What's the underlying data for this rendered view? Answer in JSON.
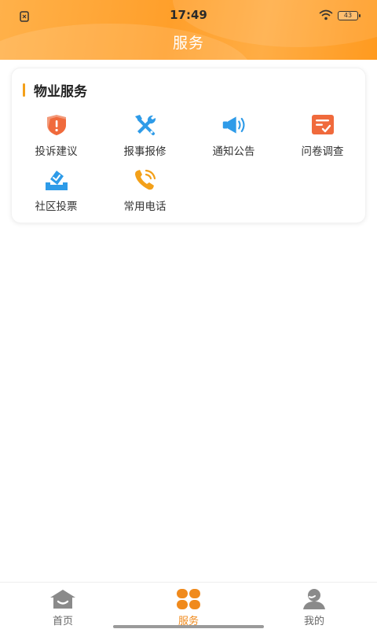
{
  "status_bar": {
    "time": "17:49",
    "battery": "43"
  },
  "header": {
    "title": "服务"
  },
  "section": {
    "title": "物业服务",
    "items": [
      {
        "label": "投诉建议",
        "icon": "shield-alert-icon",
        "color": "#f06a3c"
      },
      {
        "label": "报事报修",
        "icon": "repair-tools-icon",
        "color": "#2e9be8"
      },
      {
        "label": "通知公告",
        "icon": "megaphone-icon",
        "color": "#2e9be8"
      },
      {
        "label": "问卷调查",
        "icon": "survey-icon",
        "color": "#f06a3c"
      },
      {
        "label": "社区投票",
        "icon": "vote-box-icon",
        "color": "#2e9be8"
      },
      {
        "label": "常用电话",
        "icon": "phone-icon",
        "color": "#f3a019"
      }
    ]
  },
  "tabbar": {
    "active": 1,
    "tabs": [
      {
        "label": "首页",
        "icon": "home-icon"
      },
      {
        "label": "服务",
        "icon": "clover-grid-icon"
      },
      {
        "label": "我的",
        "icon": "user-icon"
      }
    ]
  },
  "colors": {
    "accent": "#f3a019",
    "active_tab": "#f08a1c",
    "header": "#ff9f2a"
  }
}
